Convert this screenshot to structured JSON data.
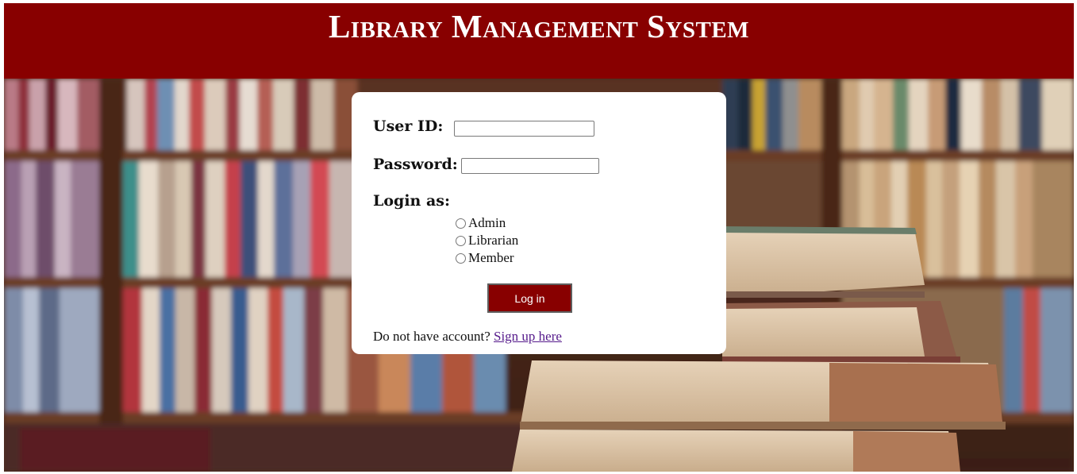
{
  "header": {
    "title": "Library Management System"
  },
  "login_form": {
    "user_id_label": "User ID:",
    "user_id_value": "",
    "password_label": "Password:",
    "password_value": "",
    "login_as_label": "Login as:",
    "roles": [
      "Admin",
      "Librarian",
      "Member"
    ],
    "selected_role": null,
    "login_button_label": "Log in",
    "signup_prompt": "Do not have account?",
    "signup_link": "Sign up here"
  },
  "colors": {
    "header_bg": "#880000",
    "button_bg": "#880000",
    "link": "#551a8b",
    "card_bg": "#ffffff"
  }
}
